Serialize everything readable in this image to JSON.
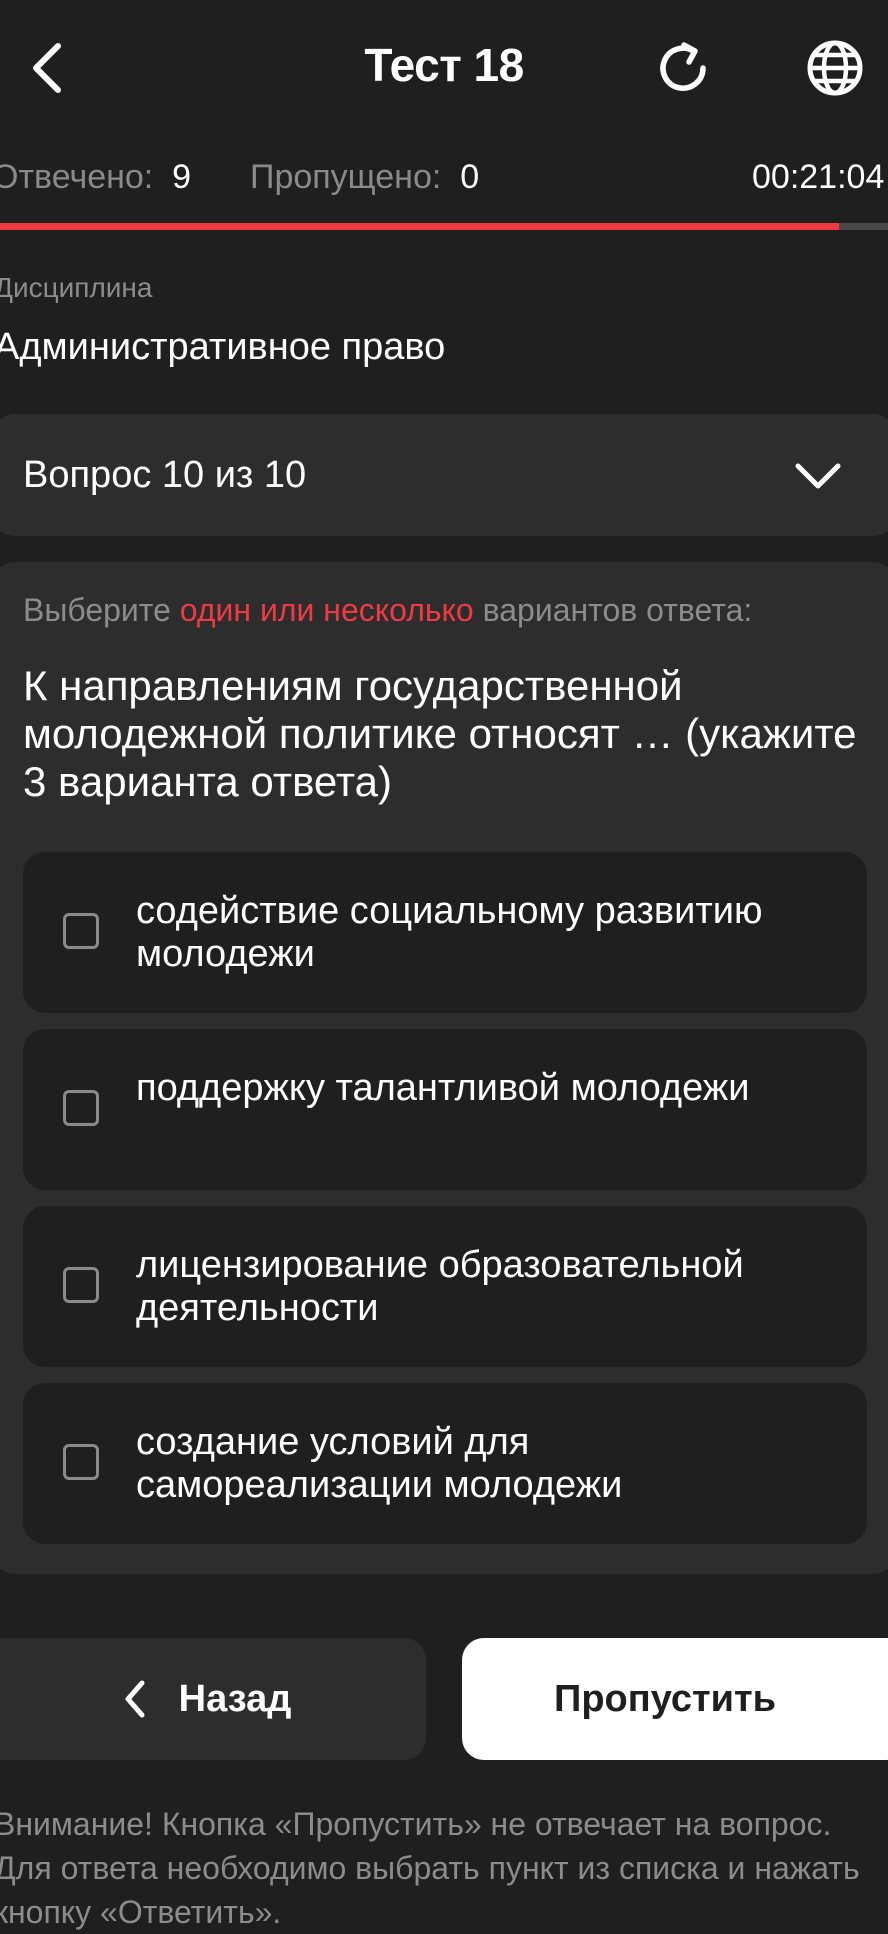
{
  "header": {
    "title": "Тест 18",
    "back_icon": "chevron-left-icon",
    "refresh_icon": "refresh-icon",
    "language_icon": "globe-icon"
  },
  "stats": {
    "answered_label": "Отвечено:",
    "answered_value": "9",
    "skipped_label": "Пропущено:",
    "skipped_value": "0",
    "timer": "00:21:04",
    "progress_fraction": 0.945
  },
  "discipline": {
    "label": "Дисциплина",
    "value": "Административное право"
  },
  "selector": {
    "label": "Вопрос 10 из 10"
  },
  "question": {
    "instruction_prefix": "Выберите ",
    "instruction_accent": "один или несколько",
    "instruction_suffix": " вариантов ответа:",
    "text": "К направлениям государственной молодежной политике относят … (укажите 3 варианта ответа)",
    "options": [
      {
        "text": "содействие социальному развитию молодежи",
        "checked": false
      },
      {
        "text": "поддержку талантливой молодежи",
        "checked": false
      },
      {
        "text": "лицензирование образовательной деятельности",
        "checked": false
      },
      {
        "text": "создание условий для самореализации молодежи",
        "checked": false
      }
    ]
  },
  "buttons": {
    "back_label": "Назад",
    "skip_label": "Пропустить"
  },
  "notice": "Внимание! Кнопка «Пропустить» не отвечает на вопрос. Для ответа необходимо выбрать пункт из списка и нажать кнопку «Ответить».",
  "colors": {
    "background": "#1f1f1f",
    "card": "#2d2d2d",
    "accent": "#ee3a43",
    "muted_text": "#8c8c8c"
  }
}
